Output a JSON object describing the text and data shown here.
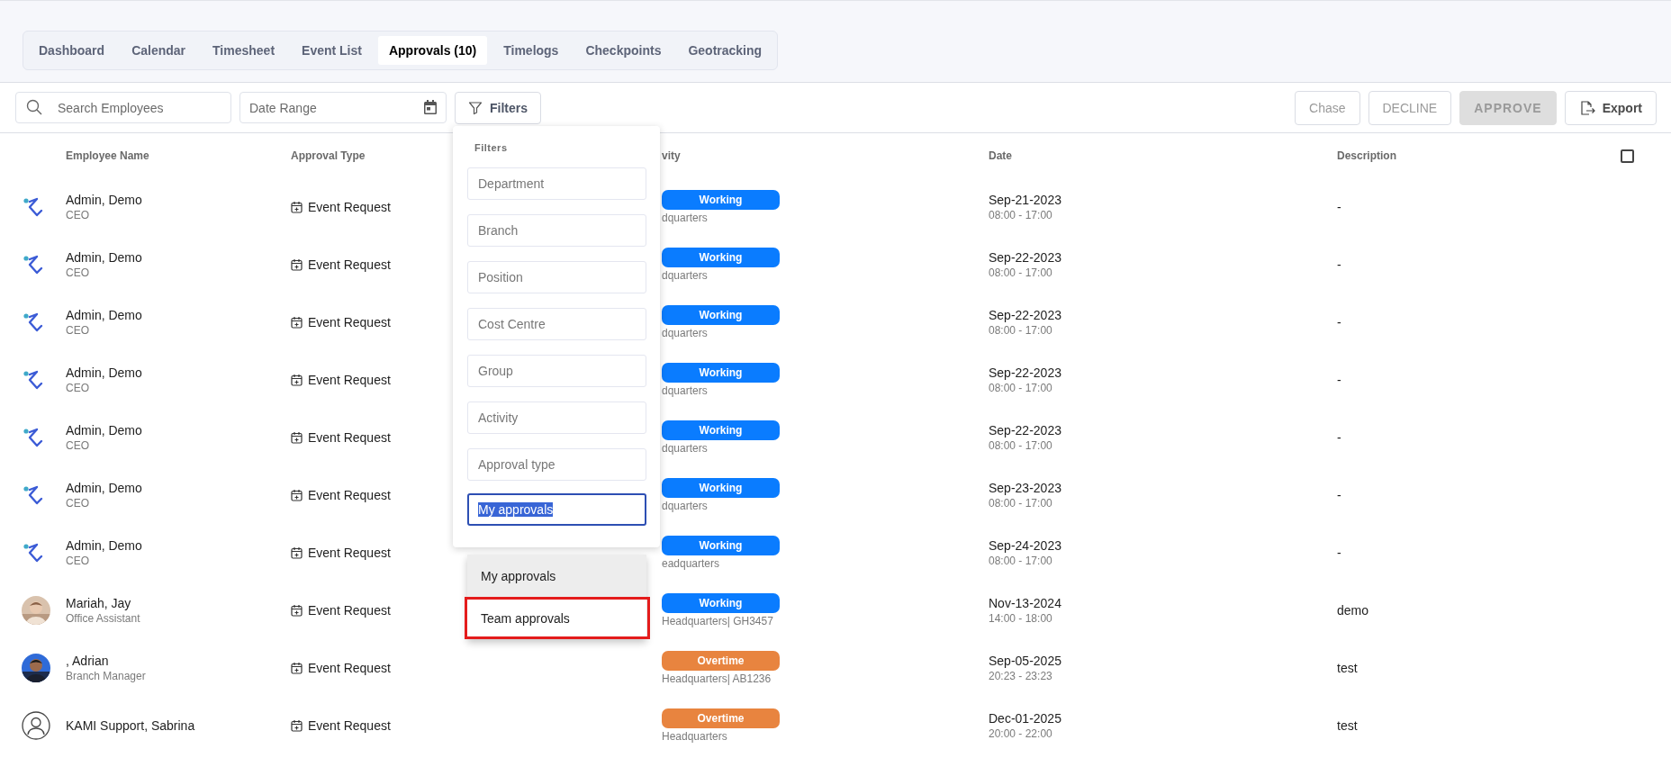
{
  "tabs": [
    {
      "label": "Dashboard",
      "selected": false
    },
    {
      "label": "Calendar",
      "selected": false
    },
    {
      "label": "Timesheet",
      "selected": false
    },
    {
      "label": "Event List",
      "selected": false
    },
    {
      "label": "Approvals (10)",
      "selected": true
    },
    {
      "label": "Timelogs",
      "selected": false
    },
    {
      "label": "Checkpoints",
      "selected": false
    },
    {
      "label": "Geotracking",
      "selected": false
    }
  ],
  "toolbar": {
    "search": {
      "placeholder": "Search Employees"
    },
    "date_range": {
      "placeholder": "Date Range"
    },
    "filters_button": "Filters",
    "actions": [
      {
        "label": "Chase",
        "kind": "outline",
        "disabled": true
      },
      {
        "label": "DECLINE",
        "kind": "outline",
        "disabled": true
      },
      {
        "label": "APPROVE",
        "kind": "filled",
        "disabled": true
      },
      {
        "label": "Export",
        "kind": "export",
        "disabled": false
      }
    ]
  },
  "table": {
    "columns": [
      "Employee Name",
      "Approval Type",
      "vity",
      "Date",
      "Description"
    ],
    "select_all": {
      "checked": false
    },
    "rows": [
      {
        "avatar": {
          "kind": "logo"
        },
        "name": "Admin, Demo",
        "role": "CEO",
        "type": "Event Request",
        "activity": {
          "label": "Working",
          "color": "#0a7cff"
        },
        "location": "dquarters",
        "date": "Sep-21-2023",
        "time": "08:00 - 17:00",
        "description": "-"
      },
      {
        "avatar": {
          "kind": "logo"
        },
        "name": "Admin, Demo",
        "role": "CEO",
        "type": "Event Request",
        "activity": {
          "label": "Working",
          "color": "#0a7cff"
        },
        "location": "dquarters",
        "date": "Sep-22-2023",
        "time": "08:00 - 17:00",
        "description": "-"
      },
      {
        "avatar": {
          "kind": "logo"
        },
        "name": "Admin, Demo",
        "role": "CEO",
        "type": "Event Request",
        "activity": {
          "label": "Working",
          "color": "#0a7cff"
        },
        "location": "dquarters",
        "date": "Sep-22-2023",
        "time": "08:00 - 17:00",
        "description": "-"
      },
      {
        "avatar": {
          "kind": "logo"
        },
        "name": "Admin, Demo",
        "role": "CEO",
        "type": "Event Request",
        "activity": {
          "label": "Working",
          "color": "#0a7cff"
        },
        "location": "dquarters",
        "date": "Sep-22-2023",
        "time": "08:00 - 17:00",
        "description": "-"
      },
      {
        "avatar": {
          "kind": "logo"
        },
        "name": "Admin, Demo",
        "role": "CEO",
        "type": "Event Request",
        "activity": {
          "label": "Working",
          "color": "#0a7cff"
        },
        "location": "dquarters",
        "date": "Sep-22-2023",
        "time": "08:00 - 17:00",
        "description": "-"
      },
      {
        "avatar": {
          "kind": "logo"
        },
        "name": "Admin, Demo",
        "role": "CEO",
        "type": "Event Request",
        "activity": {
          "label": "Working",
          "color": "#0a7cff"
        },
        "location": "dquarters",
        "date": "Sep-23-2023",
        "time": "08:00 - 17:00",
        "description": "-"
      },
      {
        "avatar": {
          "kind": "logo"
        },
        "name": "Admin, Demo",
        "role": "CEO",
        "type": "Event Request",
        "activity": {
          "label": "Working",
          "color": "#0a7cff"
        },
        "location": "eadquarters",
        "date": "Sep-24-2023",
        "time": "08:00 - 17:00",
        "description": "-"
      },
      {
        "name": "Mariah, Jay",
        "role": "Office Assistant",
        "type": "Event Request",
        "activity": {
          "label": "Working",
          "color": "#0a7cff"
        },
        "location": "Headquarters| GH3457",
        "date": "Nov-13-2024",
        "time": "14:00 - 18:00",
        "description": "demo"
      },
      {
        "name": ", Adrian",
        "role": "Branch Manager",
        "type": "Event Request",
        "activity": {
          "label": "Overtime",
          "color": "#e8843f"
        },
        "location": "Headquarters| AB1236",
        "date": "Sep-05-2025",
        "time": "20:23 - 23:23",
        "description": "test"
      },
      {
        "avatar": {
          "kind": "placeholder"
        },
        "name": "KAMI Support, Sabrina",
        "type": "Event Request",
        "activity": {
          "label": "Overtime",
          "color": "#e8843f"
        },
        "location": "Headquarters",
        "date": "Dec-01-2025",
        "time": "20:00 - 22:00",
        "description": "test"
      }
    ]
  },
  "filters": {
    "title": "Filters",
    "fields": [
      {
        "placeholder": "Department"
      },
      {
        "placeholder": "Branch"
      },
      {
        "placeholder": "Position"
      },
      {
        "placeholder": "Cost Centre"
      },
      {
        "placeholder": "Group"
      },
      {
        "placeholder": "Activity"
      },
      {
        "placeholder": "Approval type"
      }
    ],
    "select": {
      "value": "My approvals"
    },
    "options": [
      {
        "label": "My approvals",
        "selected": true,
        "highlighted": false
      },
      {
        "label": "Team approvals",
        "selected": false,
        "highlighted": true
      }
    ]
  }
}
